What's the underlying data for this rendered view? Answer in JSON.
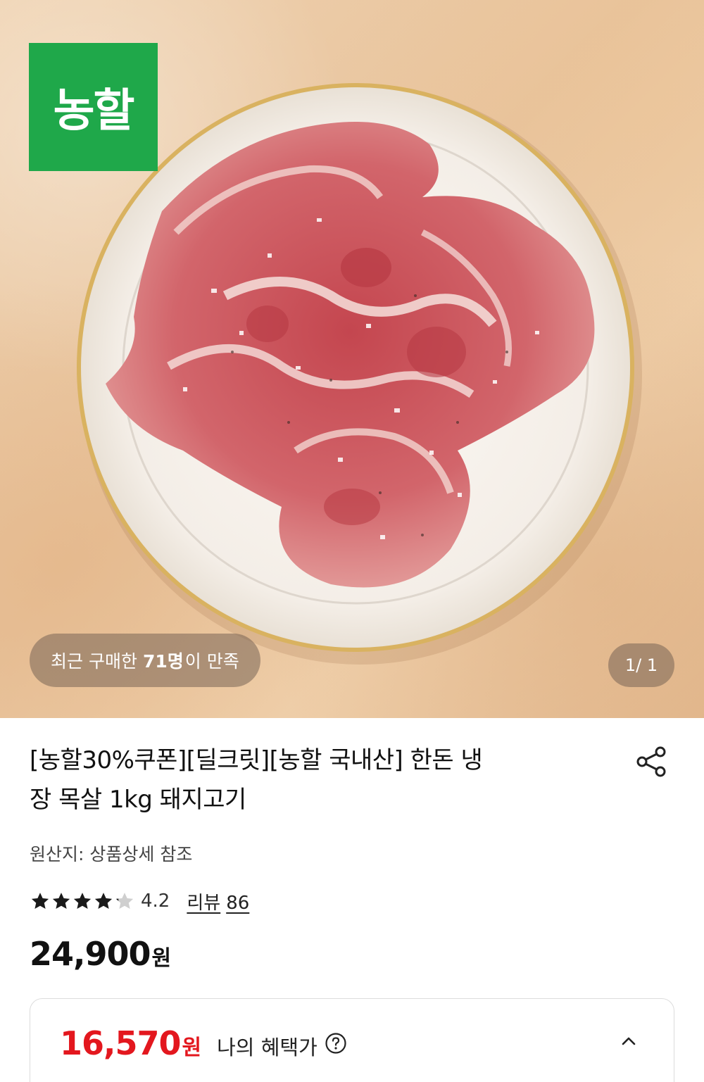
{
  "brand": {
    "logo_text": "농할",
    "logo_color": "#1fa84a"
  },
  "image_overlay": {
    "review_prefix": "최근 구매한",
    "review_count": "71명",
    "review_suffix": "이 만족",
    "counter": "1/ 1"
  },
  "product": {
    "title_line1": "[농할30%쿠폰][딜크릿][농할 국내산] 한돈 냉",
    "title_line2": "장 목살 1kg 돼지고기",
    "origin": "원산지: 상품상세 참조",
    "rating": 4.2,
    "rating_text": "4.2",
    "review_label": "리뷰",
    "review_count": "86",
    "price": "24,900",
    "price_unit": "원"
  },
  "benefit": {
    "price": "16,570",
    "price_unit": "원",
    "label": "나의 혜택가",
    "accent_color": "#e3171e"
  },
  "icons": {
    "share": "share-icon",
    "help": "help-circle-icon",
    "collapse": "chevron-up-icon",
    "star": "star-icon"
  }
}
